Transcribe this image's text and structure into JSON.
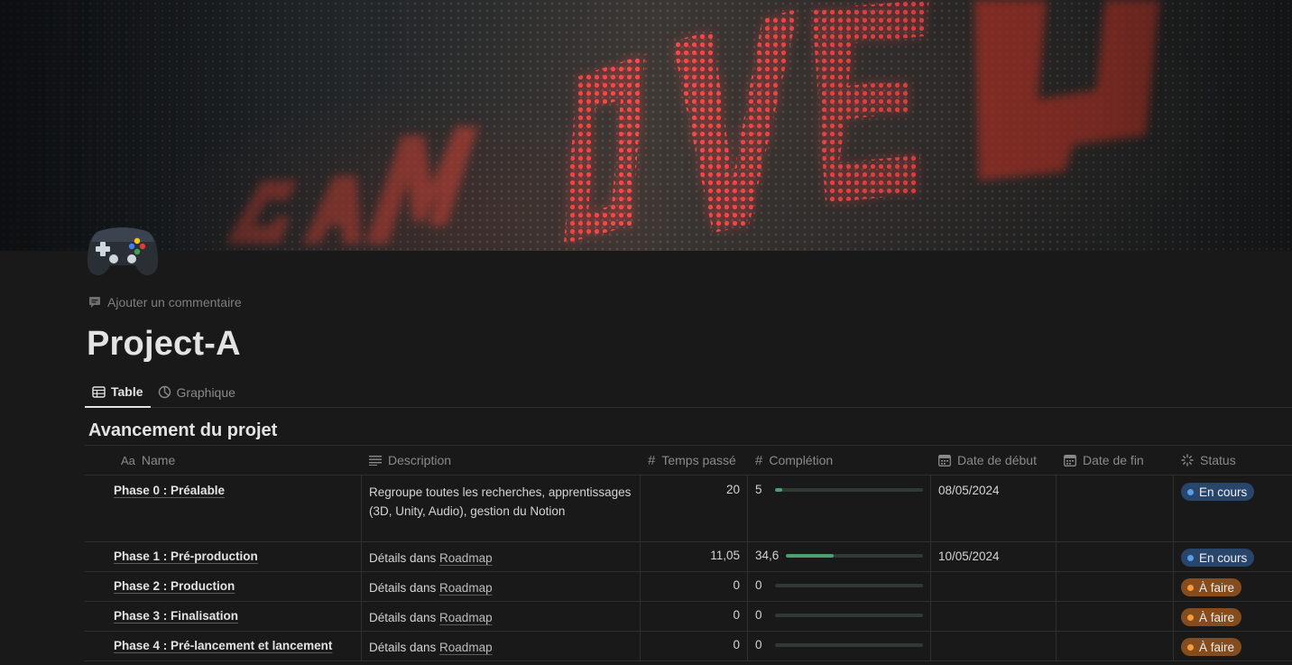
{
  "cover": {
    "caption": "GAME OVER",
    "colors": {
      "led_red": "#ff3b3b",
      "led_glow": "#d21f1f"
    }
  },
  "page": {
    "icon": "gamepad-icon",
    "add_comment_label": "Ajouter un commentaire",
    "title": "Project-A"
  },
  "tabs": [
    {
      "label": "Table",
      "icon": "table-icon",
      "active": true
    },
    {
      "label": "Graphique",
      "icon": "chart-icon",
      "active": false
    }
  ],
  "database": {
    "title": "Avancement du projet",
    "columns": {
      "name": "Name",
      "name_prefix": "Aa",
      "description": "Description",
      "time": "Temps passé",
      "completion": "Complétion",
      "start": "Date de début",
      "end": "Date de fin",
      "status": "Status"
    },
    "rows": [
      {
        "name": "Phase 0 : Préalable",
        "description": "Regroupe toutes les recherches, apprentissages (3D, Unity, Audio), gestion du Notion",
        "description_link": "",
        "time": "20",
        "completion": "5",
        "completion_pct": 5,
        "start": "08/05/2024",
        "end": "",
        "status": "En cours",
        "status_color": "blue"
      },
      {
        "name": "Phase 1 : Pré-production",
        "description": "Détails dans ",
        "description_link": "Roadmap",
        "time": "11,05",
        "completion": "34,6",
        "completion_pct": 34.6,
        "start": "10/05/2024",
        "end": "",
        "status": "En cours",
        "status_color": "blue"
      },
      {
        "name": "Phase 2 : Production",
        "description": "Détails dans ",
        "description_link": "Roadmap",
        "time": "0",
        "completion": "0",
        "completion_pct": 0,
        "start": "",
        "end": "",
        "status": "À faire",
        "status_color": "orange"
      },
      {
        "name": "Phase 3 : Finalisation",
        "description": "Détails dans ",
        "description_link": "Roadmap",
        "time": "0",
        "completion": "0",
        "completion_pct": 0,
        "start": "",
        "end": "",
        "status": "À faire",
        "status_color": "orange"
      },
      {
        "name": "Phase 4 : Pré-lancement et lancement",
        "description": "Détails dans ",
        "description_link": "Roadmap",
        "time": "0",
        "completion": "0",
        "completion_pct": 0,
        "start": "",
        "end": "",
        "status": "À faire",
        "status_color": "orange"
      }
    ]
  }
}
